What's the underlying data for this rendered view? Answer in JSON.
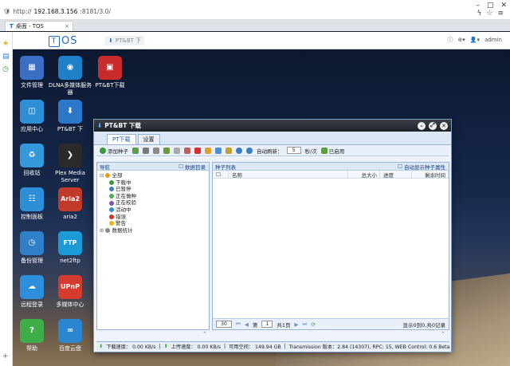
{
  "browser": {
    "url_scheme": "http://",
    "url_host": "192.168.3.156",
    "url_rest": ":8181/3.0/",
    "tab_title": "桌面 - TOS"
  },
  "tos": {
    "logo": "OS",
    "logo_box": "T",
    "task_button": "PT&BT 下",
    "user": "admin"
  },
  "desktop_icons": [
    {
      "label": "文件管理",
      "color": "#3a6fc4",
      "glyph": "▦"
    },
    {
      "label": "DLNA多媒体服务器",
      "color": "#1f7fc7",
      "glyph": "◉"
    },
    {
      "label": "PT&BT下载",
      "color": "#c92a2a",
      "glyph": "▣"
    },
    {
      "label": "应用中心",
      "color": "#2f8fd6",
      "glyph": "◫"
    },
    {
      "label": "PT&BT 下",
      "color": "#2b78c9",
      "glyph": "⬇"
    },
    {
      "label": "回收站",
      "color": "#3498db",
      "glyph": "♻"
    },
    {
      "label": "Plex Media Server",
      "color": "#2a2a2a",
      "glyph": "❯"
    },
    {
      "label": "控制面板",
      "color": "#2c8fd8",
      "glyph": "☷"
    },
    {
      "label": "aria2",
      "color": "#c0392b",
      "glyph": "Aria2"
    },
    {
      "label": "备份管理",
      "color": "#2f80c9",
      "glyph": "◷"
    },
    {
      "label": "net2ftp",
      "color": "#1b9ad6",
      "glyph": "FTP"
    },
    {
      "label": "远程登录",
      "color": "#2e8fdc",
      "glyph": "☁"
    },
    {
      "label": "多媒体中心",
      "color": "#d63b2f",
      "glyph": "UPnP"
    },
    {
      "label": "帮助",
      "color": "#3fae49",
      "glyph": "?"
    },
    {
      "label": "百度云盘",
      "color": "#2a86d1",
      "glyph": "∞"
    }
  ],
  "window": {
    "title": "PT&BT 下载",
    "tabs": [
      "PT下载",
      "设置"
    ],
    "toolbar": {
      "add_seed": "添加种子",
      "auto_refresh_label": "自动刷新：",
      "refresh_value": "5",
      "refresh_unit": "秒/次",
      "enabled": "已启用"
    },
    "left_pane": {
      "title": "导航",
      "data_dir": "数据目录",
      "tree": [
        {
          "label": "全部",
          "color": "#e7a21b"
        },
        {
          "label": "下载中",
          "color": "#3a9b3a"
        },
        {
          "label": "已暂停",
          "color": "#3a7fc4"
        },
        {
          "label": "正在做种",
          "color": "#4caf50"
        },
        {
          "label": "正在校验",
          "color": "#7a55b8"
        },
        {
          "label": "活动中",
          "color": "#2c8fd8"
        },
        {
          "label": "错误",
          "color": "#d9302b"
        },
        {
          "label": "警告",
          "color": "#f0b418"
        },
        {
          "label": "数据统计",
          "color": "#8a8a8a"
        }
      ]
    },
    "right_pane": {
      "title": "种子列表",
      "auto_show": "自动显示种子属性",
      "columns": [
        "名称",
        "总大小",
        "进度",
        "剩余时间"
      ]
    },
    "pager": {
      "page_size": "30",
      "page_prefix": "第",
      "page_value": "1",
      "page_suffix": "共1页",
      "summary": "显示0到0,共0记录"
    },
    "status": {
      "down": "下载速度： 0.00 KB/s",
      "up": "上传速度： 0.00 KB/s",
      "space": "可用空间： 149.94 GB",
      "version": "Transmission 版本：2.84 (14307), RPC: 15, WEB Control: 0.6 Beta(20130913)"
    }
  }
}
